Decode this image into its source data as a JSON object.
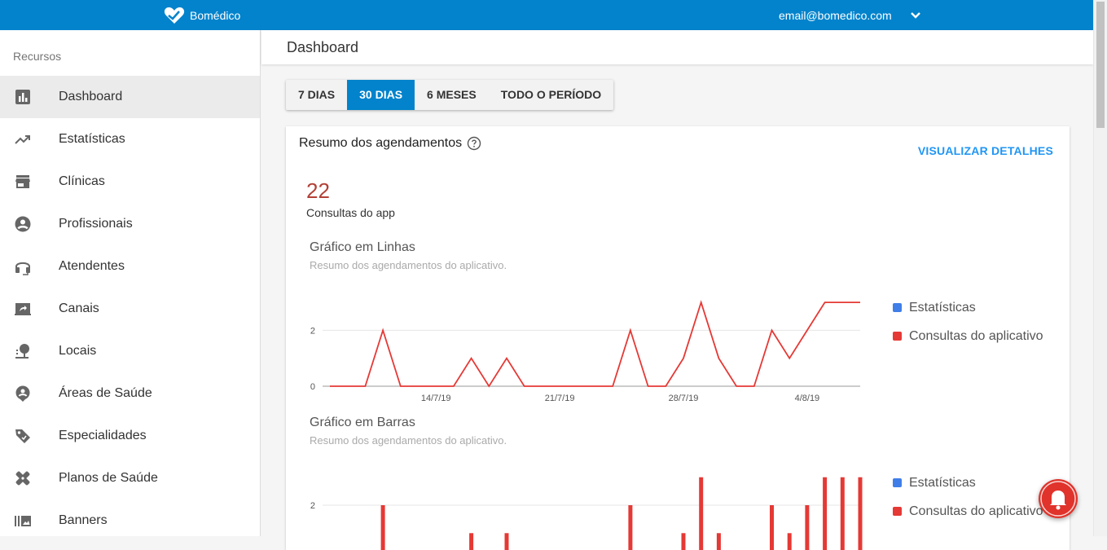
{
  "app": {
    "name": "Bomédico"
  },
  "user": {
    "email": "email@bomedico.com"
  },
  "colors": {
    "primary": "#0283cc",
    "series_line": "#e53935",
    "legend_blue": "#3f7ee8",
    "kpi": "#b34036"
  },
  "sidebar": {
    "heading": "Recursos",
    "items": [
      {
        "label": "Dashboard",
        "icon": "bar-chart-icon"
      },
      {
        "label": "Estatísticas",
        "icon": "trending-up-icon"
      },
      {
        "label": "Clínicas",
        "icon": "store-icon"
      },
      {
        "label": "Profissionais",
        "icon": "account-circle-icon"
      },
      {
        "label": "Atendentes",
        "icon": "headset-icon"
      },
      {
        "label": "Canais",
        "icon": "screen-share-icon"
      },
      {
        "label": "Locais",
        "icon": "map-pin-icon"
      },
      {
        "label": "Áreas de Saúde",
        "icon": "person-pin-icon"
      },
      {
        "label": "Especialidades",
        "icon": "tag-icon"
      },
      {
        "label": "Planos de Saúde",
        "icon": "healing-icon"
      },
      {
        "label": "Banners",
        "icon": "photo-library-icon"
      }
    ]
  },
  "page": {
    "title": "Dashboard"
  },
  "period_tabs": [
    {
      "label": "7 DIAS",
      "selected": false
    },
    {
      "label": "30 DIAS",
      "selected": true
    },
    {
      "label": "6 MESES",
      "selected": false
    },
    {
      "label": "TODO O PERÍODO",
      "selected": false
    }
  ],
  "card": {
    "title": "Resumo dos agendamentos",
    "details_link": "VISUALIZAR DETALHES",
    "kpi_value": "22",
    "kpi_label": "Consultas do app"
  },
  "chart_data": [
    {
      "type": "line",
      "title": "Gráfico em Linhas",
      "subtitle": "Resumo dos agendamentos do aplicativo.",
      "x": [
        "8/7/19",
        "9/7/19",
        "10/7/19",
        "11/7/19",
        "12/7/19",
        "13/7/19",
        "14/7/19",
        "15/7/19",
        "16/7/19",
        "17/7/19",
        "18/7/19",
        "19/7/19",
        "20/7/19",
        "21/7/19",
        "22/7/19",
        "23/7/19",
        "24/7/19",
        "25/7/19",
        "26/7/19",
        "27/7/19",
        "28/7/19",
        "29/7/19",
        "30/7/19",
        "31/7/19",
        "1/8/19",
        "2/8/19",
        "3/8/19",
        "4/8/19",
        "5/8/19",
        "6/8/19",
        "7/8/19"
      ],
      "x_ticks": [
        "14/7/19",
        "21/7/19",
        "28/7/19",
        "4/8/19"
      ],
      "y_ticks": [
        0,
        2
      ],
      "ylim": [
        0,
        3
      ],
      "grid": true,
      "legend": "right",
      "series": [
        {
          "name": "Estatísticas",
          "color": "#3f7ee8",
          "values": []
        },
        {
          "name": "Consultas do aplicativo",
          "color": "#e53935",
          "values": [
            0,
            0,
            0,
            2,
            0,
            0,
            0,
            0,
            1,
            0,
            1,
            0,
            0,
            0,
            0,
            0,
            0,
            2,
            0,
            0,
            1,
            3,
            1,
            0,
            0,
            2,
            1,
            2,
            3,
            3,
            3
          ]
        }
      ]
    },
    {
      "type": "bar",
      "title": "Gráfico em Barras",
      "subtitle": "Resumo dos agendamentos do aplicativo.",
      "x": [
        "8/7/19",
        "9/7/19",
        "10/7/19",
        "11/7/19",
        "12/7/19",
        "13/7/19",
        "14/7/19",
        "15/7/19",
        "16/7/19",
        "17/7/19",
        "18/7/19",
        "19/7/19",
        "20/7/19",
        "21/7/19",
        "22/7/19",
        "23/7/19",
        "24/7/19",
        "25/7/19",
        "26/7/19",
        "27/7/19",
        "28/7/19",
        "29/7/19",
        "30/7/19",
        "31/7/19",
        "1/8/19",
        "2/8/19",
        "3/8/19",
        "4/8/19",
        "5/8/19",
        "6/8/19",
        "7/8/19"
      ],
      "y_ticks": [
        2
      ],
      "ylim": [
        0,
        3
      ],
      "grid": true,
      "legend": "right",
      "series": [
        {
          "name": "Estatísticas",
          "color": "#3f7ee8",
          "values": []
        },
        {
          "name": "Consultas do aplicativo",
          "color": "#e53935",
          "values": [
            0,
            0,
            0,
            2,
            0,
            0,
            0,
            0,
            1,
            0,
            1,
            0,
            0,
            0,
            0,
            0,
            0,
            2,
            0,
            0,
            1,
            3,
            1,
            0,
            0,
            2,
            1,
            2,
            3,
            3,
            3
          ]
        }
      ]
    }
  ]
}
